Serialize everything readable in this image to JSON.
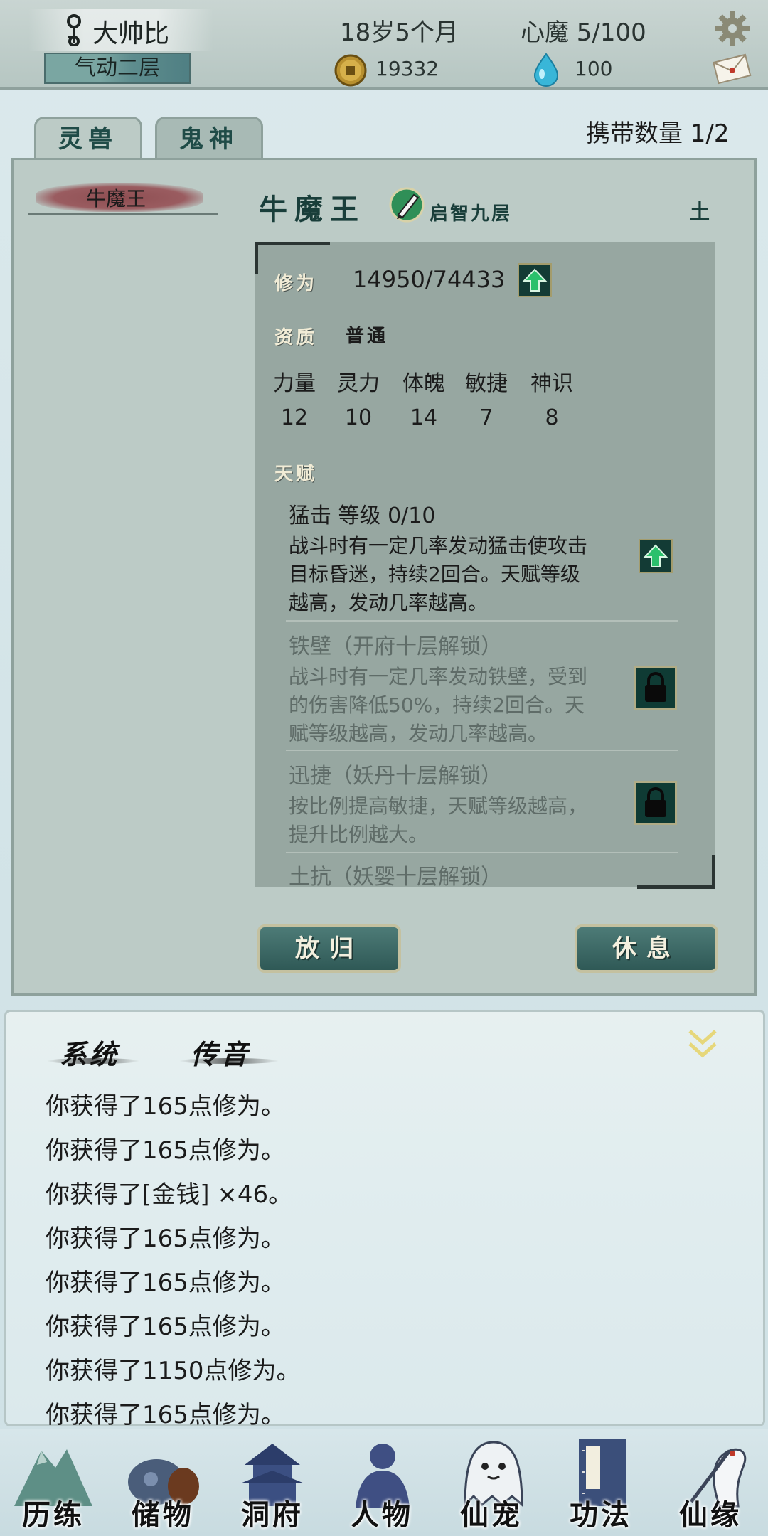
{
  "header": {
    "player_name": "大帅比",
    "realm": "气动二层",
    "age": "18岁5个月",
    "heart_demon": "心魔  5/100",
    "coins": "19332",
    "spirit_stones": "100",
    "icons": [
      "key-icon",
      "gear-icon",
      "coin-icon",
      "water-drop-icon",
      "mail-icon"
    ]
  },
  "tabs": [
    {
      "label": "灵兽",
      "active": true
    },
    {
      "label": "鬼神",
      "active": false
    }
  ],
  "carry_count": "携带数量   1/2",
  "pet_list": [
    "牛魔王"
  ],
  "pet": {
    "name": "牛魔王",
    "level": "启智九层",
    "element": "土",
    "cultivation_label": "修为",
    "cultivation_value": "14950/74433",
    "aptitude_label": "资质",
    "aptitude_value": "普通",
    "attributes": [
      {
        "name": "力量",
        "value": "12"
      },
      {
        "name": "灵力",
        "value": "10"
      },
      {
        "name": "体魄",
        "value": "14"
      },
      {
        "name": "敏捷",
        "value": "7"
      },
      {
        "name": "神识",
        "value": "8"
      }
    ],
    "talent_label": "天赋",
    "talents": [
      {
        "title": "猛击   等级  0/10",
        "desc": [
          "战斗时有一定几率发动猛击使攻击",
          "目标昏迷，持续2回合。天赋等级",
          "越高，发动几率越高。"
        ],
        "locked": false
      },
      {
        "title": "铁壁（开府十层解锁）",
        "desc": [
          "战斗时有一定几率发动铁壁，受到",
          "的伤害降低50%，持续2回合。天",
          "赋等级越高，发动几率越高。"
        ],
        "locked": true
      },
      {
        "title": "迅捷（妖丹十层解锁）",
        "desc": [
          "按比例提高敏捷，天赋等级越高，",
          "提升比例越大。"
        ],
        "locked": true
      },
      {
        "title": "土抗（妖婴十层解锁）",
        "desc": [],
        "locked": true
      }
    ]
  },
  "actions": {
    "release": "放归",
    "rest": "休息"
  },
  "log": {
    "tabs": [
      "系统",
      "传音"
    ],
    "lines": [
      "你获得了165点修为。",
      "你获得了165点修为。",
      "你获得了[金钱] ×46。",
      "你获得了165点修为。",
      "你获得了165点修为。",
      "你获得了165点修为。",
      "你获得了1150点修为。",
      "你获得了165点修为。"
    ]
  },
  "nav": [
    "历练",
    "储物",
    "洞府",
    "人物",
    "仙宠",
    "功法",
    "仙缘"
  ],
  "colors": {
    "panel": "#bccbc6",
    "stat_panel": "#97a7a1",
    "accent": "#193e3a",
    "button": "#2f5956"
  }
}
